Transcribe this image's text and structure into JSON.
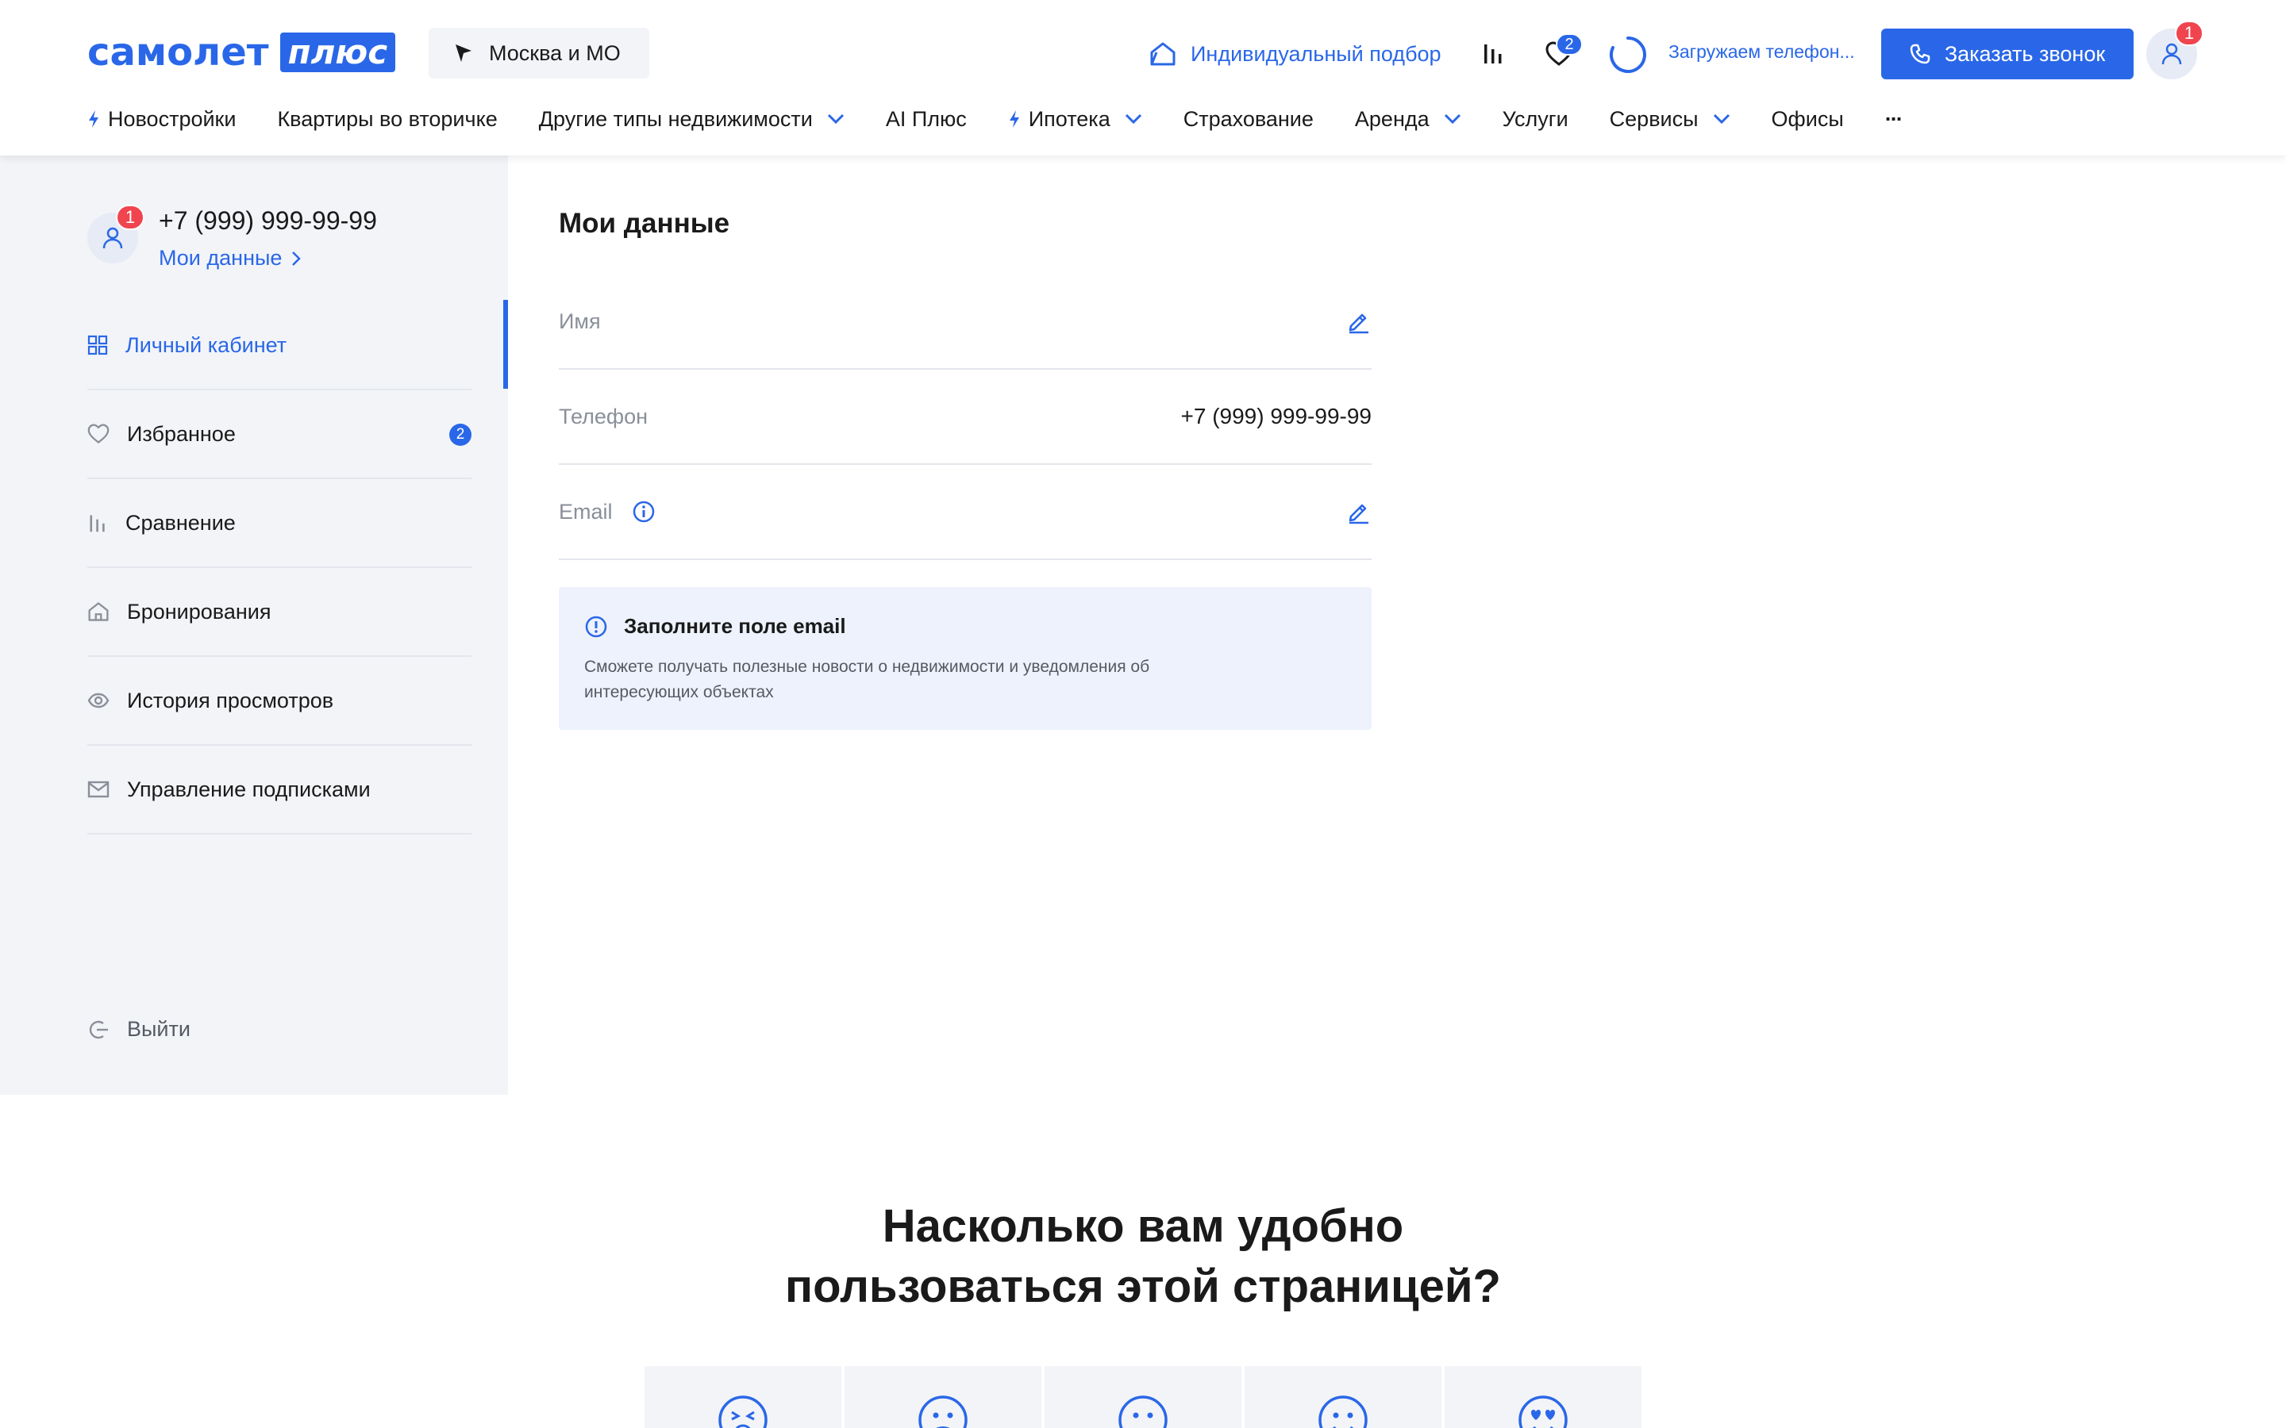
{
  "header": {
    "logo_word": "самолет",
    "logo_plus": "плюс",
    "region": "Москва и МО",
    "individual_selection": "Индивидуальный подбор",
    "favorites_count": "2",
    "loading_phone": "Загружаем телефон...",
    "call_button": "Заказать звонок",
    "profile_badge": "1"
  },
  "nav": {
    "items": [
      {
        "label": "Новостройки"
      },
      {
        "label": "Квартиры во вторичке"
      },
      {
        "label": "Другие типы недвижимости"
      },
      {
        "label": "AI Плюс"
      },
      {
        "label": "Ипотека"
      },
      {
        "label": "Страхование"
      },
      {
        "label": "Аренда"
      },
      {
        "label": "Услуги"
      },
      {
        "label": "Сервисы"
      },
      {
        "label": "Офисы"
      }
    ],
    "more": "···"
  },
  "sidebar": {
    "phone": "+7 (999) 999-99-99",
    "my_data_link": "Мои данные",
    "avatar_badge": "1",
    "menu": [
      {
        "label": "Личный кабинет",
        "icon": "grid-icon",
        "active": true
      },
      {
        "label": "Избранное",
        "icon": "heart-icon",
        "badge": "2"
      },
      {
        "label": "Сравнение",
        "icon": "bars-icon"
      },
      {
        "label": "Бронирования",
        "icon": "house-icon"
      },
      {
        "label": "История просмотров",
        "icon": "eye-icon"
      },
      {
        "label": "Управление подписками",
        "icon": "mail-icon"
      }
    ],
    "logout": "Выйти"
  },
  "main": {
    "title": "Мои данные",
    "fields": {
      "name_label": "Имя",
      "phone_label": "Телефон",
      "phone_value": "+7 (999) 999-99-99",
      "email_label": "Email"
    },
    "notice": {
      "title": "Заполните поле email",
      "text": "Сможете получать полезные новости о недвижимости и уведомления об интересующих объектах"
    }
  },
  "survey": {
    "title_line1": "Насколько вам удобно",
    "title_line2": "пользоваться этой страницей?"
  },
  "colors": {
    "accent": "#2a67e8",
    "badge_red": "#f0454f",
    "sidebar_bg": "#f2f4f7",
    "notice_bg": "#edf2fc"
  }
}
